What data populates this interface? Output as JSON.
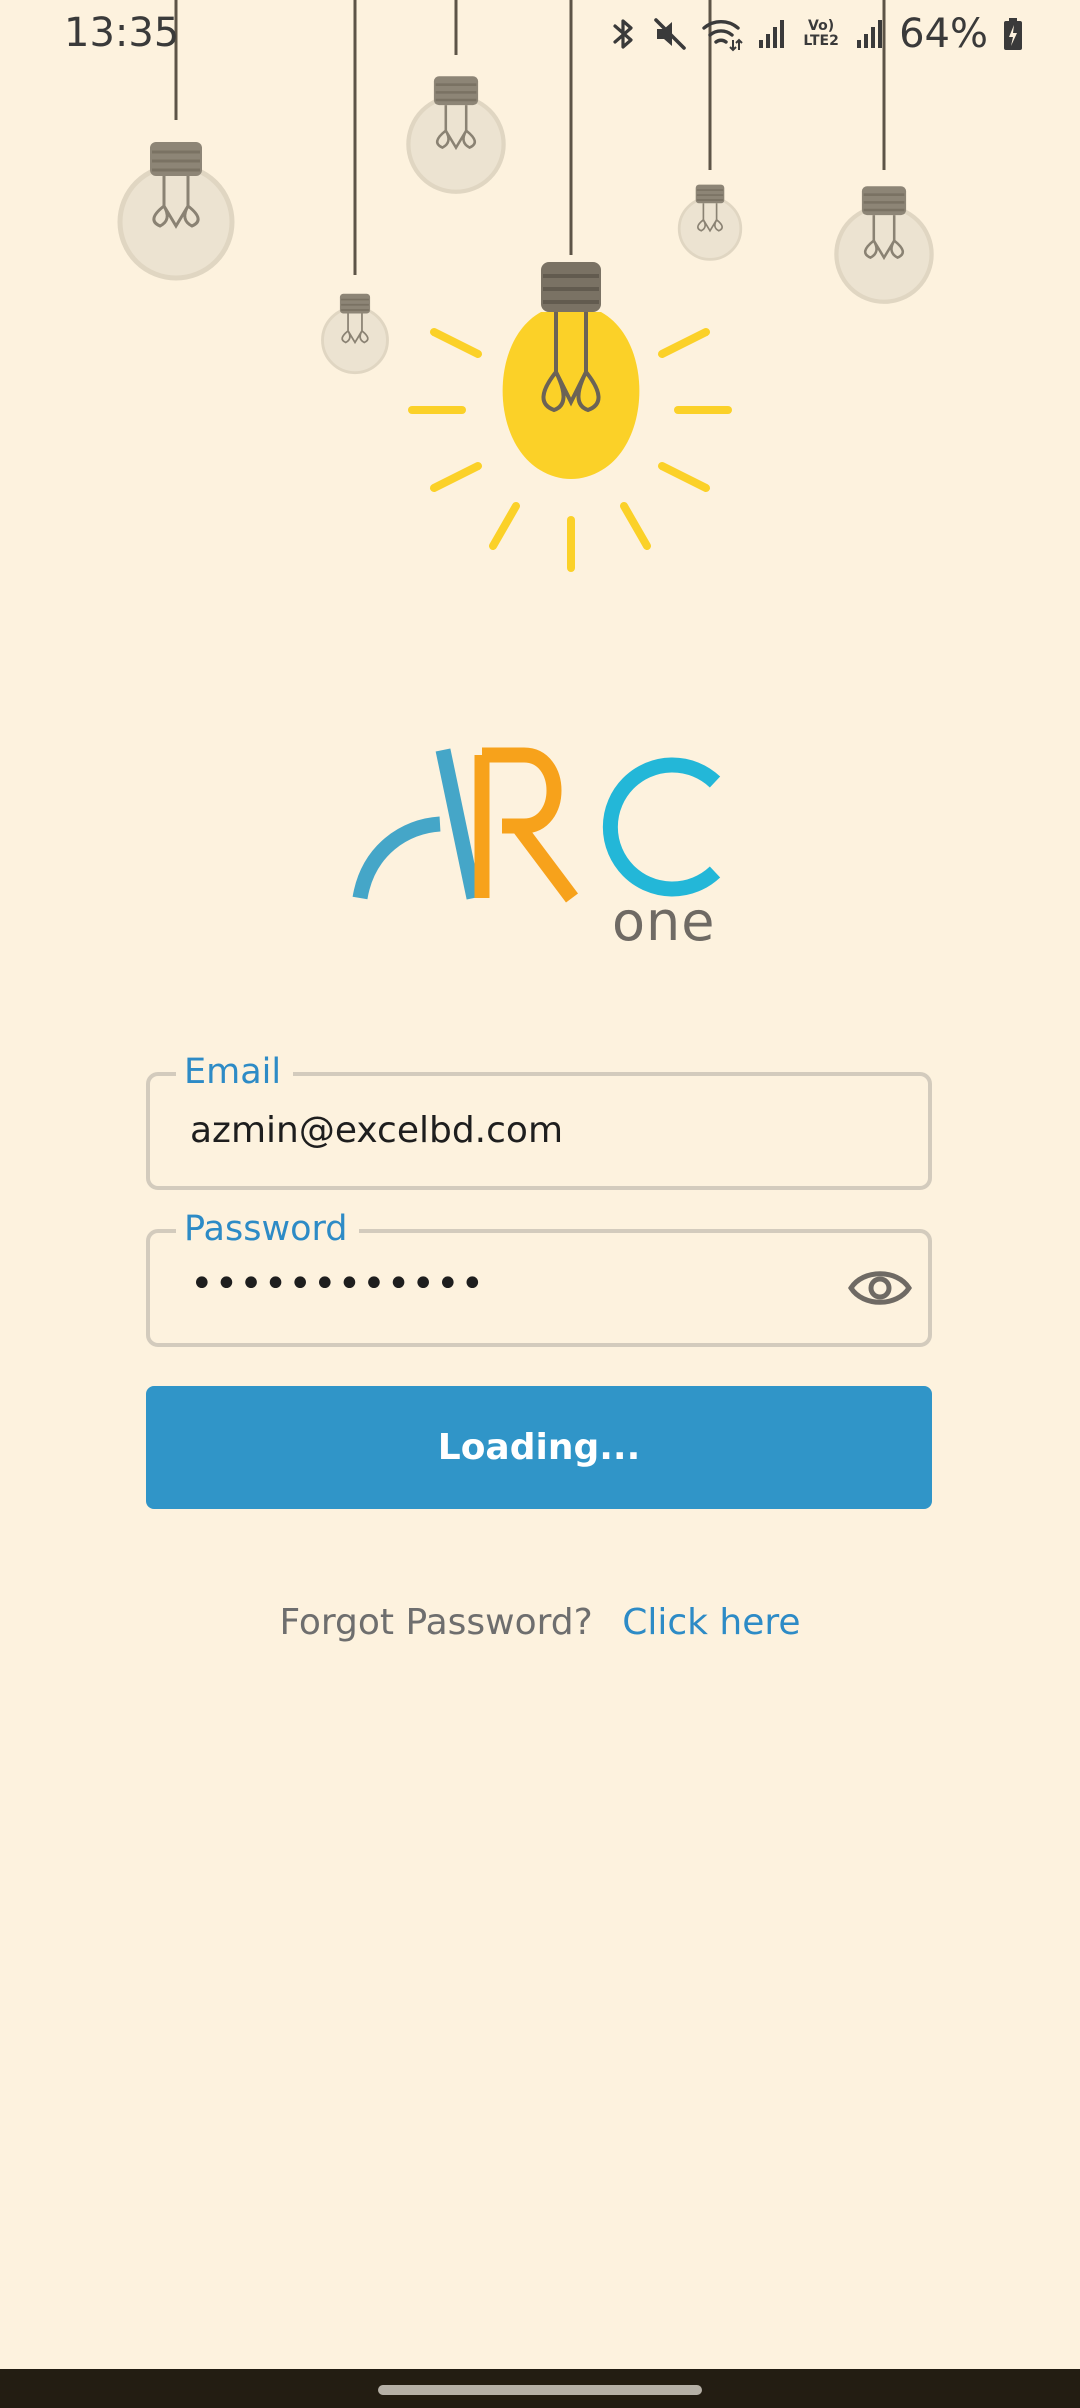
{
  "status_bar": {
    "time": "13:35",
    "network_label": "Vo) LTE2",
    "battery": "64%",
    "icons": [
      "bluetooth-icon",
      "mute-icon",
      "wifi-icon",
      "signal-icon",
      "signal-icon",
      "battery-icon"
    ]
  },
  "logo": {
    "name": "ARC",
    "sub": "one",
    "colors": {
      "a": "#45a6c8",
      "r": "#f7a21b",
      "c": "#23b7d8",
      "sub": "#6f6a64"
    }
  },
  "form": {
    "email": {
      "label": "Email",
      "value": "azmin@excelbd.com"
    },
    "password": {
      "label": "Password",
      "value": "••••••••••••"
    }
  },
  "login_button": {
    "label": "Loading..."
  },
  "forgot": {
    "text": "Forgot Password?",
    "link": "Click here"
  },
  "theme": {
    "background": "#fdf2de",
    "accent": "#3095c8",
    "link": "#2d8bc6",
    "bulb_yellow": "#fbd128",
    "nav_bar": "#231d12"
  }
}
